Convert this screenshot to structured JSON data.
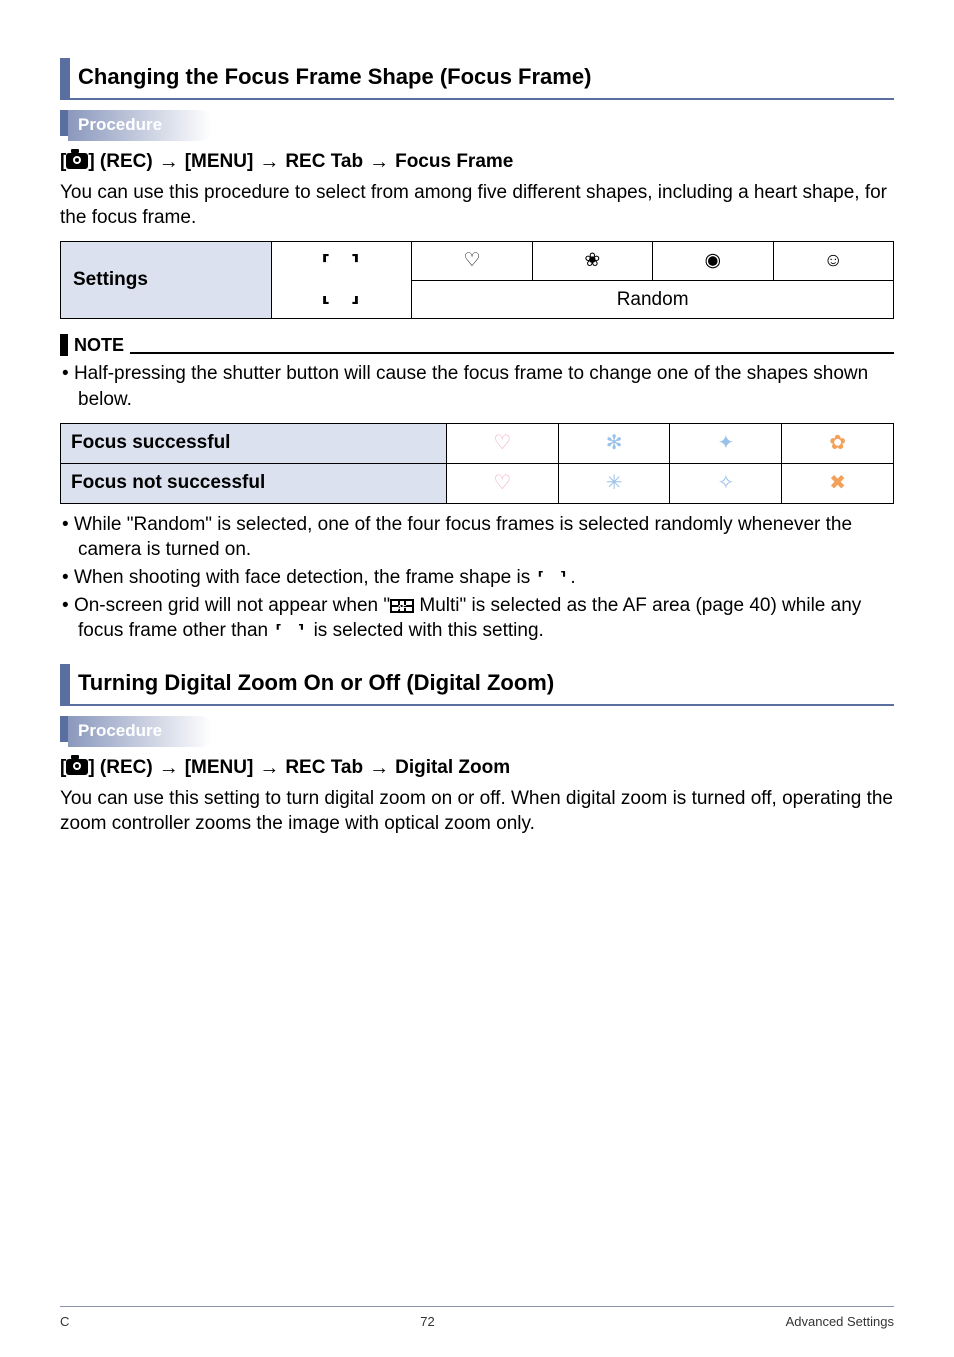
{
  "section1": {
    "title": "Changing the Focus Frame Shape (Focus Frame)",
    "procedure_label": "Procedure",
    "path": {
      "p1": "] (REC)",
      "p2": "[MENU]",
      "p3": "REC Tab",
      "p4": "Focus Frame"
    },
    "intro": "You can use this procedure to select from among five different shapes, including a heart shape, for the focus frame.",
    "settings_label": "Settings",
    "random_label": "Random",
    "icons": {
      "heart": "♡",
      "flower": "❀",
      "camera": "◉",
      "person": "☺"
    }
  },
  "note": {
    "label": "NOTE",
    "b1": "Half-pressing the shutter button will cause the focus frame to change one of the shapes shown below.",
    "row1_label": "Focus successful",
    "row2_label": "Focus not successful",
    "r1": {
      "c1": "♡",
      "c2": "✻",
      "c3": "✦",
      "c4": "✿"
    },
    "r2": {
      "c1": "♡",
      "c2": "✳",
      "c3": "✧",
      "c4": "✖"
    },
    "b2": "While \"Random\" is selected, one of the four focus frames is selected randomly whenever the camera is turned on.",
    "b3_a": "When shooting with face detection, the frame shape is ",
    "b3_b": ".",
    "b4_a": "On-screen grid will not appear when \"",
    "b4_b": " Multi\" is selected as the AF area (page 40) while any focus frame other than ",
    "b4_c": " is selected with this setting."
  },
  "section2": {
    "title": "Turning Digital Zoom On or Off (Digital Zoom)",
    "procedure_label": "Procedure",
    "path": {
      "p1": "] (REC)",
      "p2": "[MENU]",
      "p3": "REC Tab",
      "p4": "Digital Zoom"
    },
    "intro": "You can use this setting to turn digital zoom on or off. When digital zoom is turned off, operating the zoom controller zooms the image with optical zoom only."
  },
  "footer": {
    "left": "C",
    "page": "72",
    "right": "Advanced Settings"
  },
  "arrow": "→"
}
